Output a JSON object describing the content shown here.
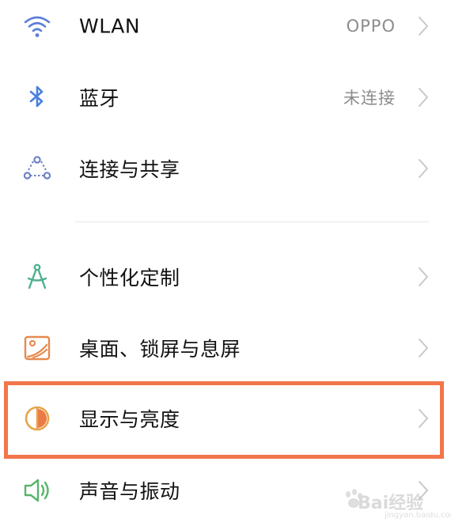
{
  "settings": {
    "items": [
      {
        "label": "WLAN",
        "value": "OPPO",
        "icon": "wifi-icon",
        "icon_color": "#5b7fd8"
      },
      {
        "label": "蓝牙",
        "value": "未连接",
        "icon": "bluetooth-icon",
        "icon_color": "#4a7fe0"
      },
      {
        "label": "连接与共享",
        "value": "",
        "icon": "connection-share-icon",
        "icon_color": "#6f82c9"
      },
      {
        "label": "个性化定制",
        "value": "",
        "icon": "compass-icon",
        "icon_color": "#4fb08e"
      },
      {
        "label": "桌面、锁屏与息屏",
        "value": "",
        "icon": "wallpaper-icon",
        "icon_color": "#e78a4f"
      },
      {
        "label": "显示与亮度",
        "value": "",
        "icon": "brightness-icon",
        "icon_color": "#e7a44a"
      },
      {
        "label": "声音与振动",
        "value": "",
        "icon": "speaker-icon",
        "icon_color": "#58b56a"
      }
    ]
  },
  "highlight": {
    "color": "#f2764b",
    "target": "显示与亮度"
  },
  "watermark": {
    "text": "Bai经验",
    "sub": "jingyan.baidu.com"
  }
}
